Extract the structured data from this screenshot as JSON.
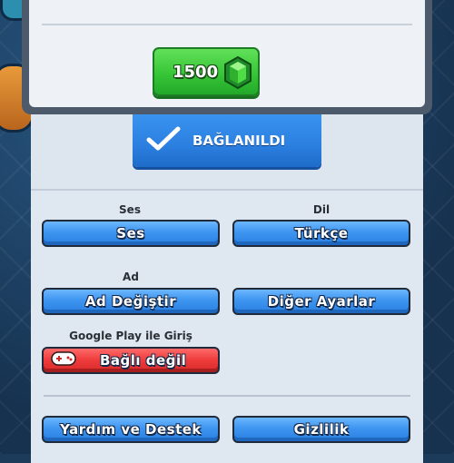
{
  "gems": {
    "amount": "1500",
    "icon": "gem-icon"
  },
  "connection": {
    "label": "BAĞLANILDI",
    "icon": "checkmark-icon"
  },
  "settings": {
    "sound_label": "Ses",
    "sound_button": "Ses",
    "language_label": "Dil",
    "language_button": "Türkçe",
    "name_label": "Ad",
    "change_name_button": "Ad Değiştir",
    "other_settings_button": "Diğer Ayarlar",
    "google_label": "Google Play ile Giriş",
    "google_button": "Bağlı değil",
    "google_icon": "gamepad-icon",
    "help_button": "Yardım ve Destek",
    "privacy_button": "Gizlilik"
  },
  "colors": {
    "primary_blue": "#2b7fe0",
    "gem_green": "#37c637",
    "alert_red": "#ee3a3a"
  }
}
